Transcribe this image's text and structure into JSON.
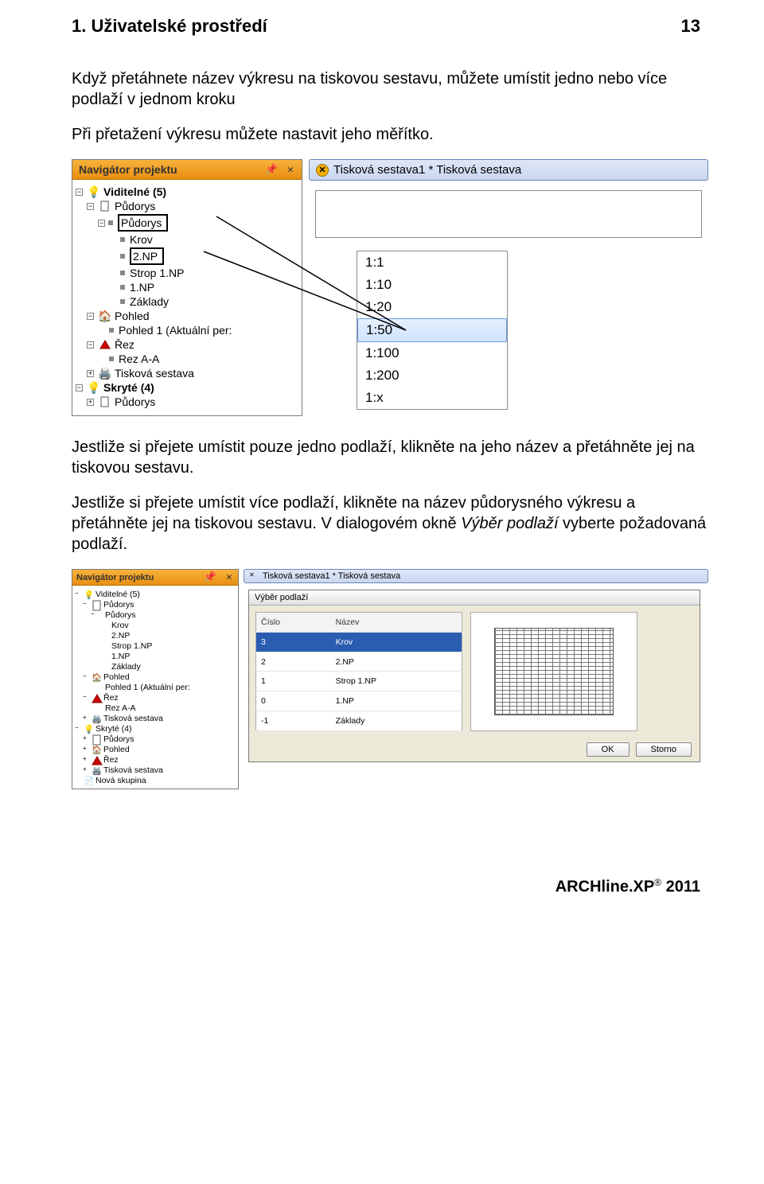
{
  "header": {
    "title": "1. Uživatelské prostředí",
    "page": "13"
  },
  "para1": "Když přetáhnete název výkresu na tiskovou sestavu, můžete umístit jedno nebo více podlaží v jednom kroku",
  "para2": "Při přetažení výkresu můžete nastavit jeho měřítko.",
  "para3": "Jestliže si přejete umístit pouze jedno podlaží, klikněte na jeho název a přetáhněte jej na tiskovou sestavu.",
  "para4a": "Jestliže si přejete umístit více podlaží, klikněte na název půdorysného výkresu a přetáhněte jej na tiskovou sestavu. V dialogovém okně ",
  "para4_italic": "Výběr podlaží",
  "para4b": " vyberte požadovaná podlaží.",
  "footer": {
    "brand": "ARCHline.XP",
    "reg": "®",
    "year": " 2011"
  },
  "shot1": {
    "nav_title": "Navigátor projektu",
    "nav_ctl": "✕",
    "tab_label": "Tisková sestava1 * Tisková sestava",
    "tree": {
      "visible": "Viditelné (5)",
      "pudorys_group": "Půdorys",
      "pudorys": "Půdorys",
      "krov": "Krov",
      "np2": "2.NP",
      "strop": "Strop 1.NP",
      "np1": "1.NP",
      "zaklady": "Základy",
      "pohled": "Pohled",
      "pohled1": "Pohled 1 (Aktuální per:",
      "rez": "Řez",
      "reza": "Rez A-A",
      "tiskova": "Tisková sestava",
      "skryte": "Skryté (4)",
      "pudorys2": "Půdorys"
    },
    "scales": [
      "1:1",
      "1:10",
      "1:20",
      "1:50",
      "1:100",
      "1:200",
      "1:x"
    ],
    "scale_selected": 3
  },
  "shot2": {
    "nav_title": "Navigátor projektu",
    "nav_ctl": "✕",
    "tab_label": "Tisková sestava1 * Tisková sestava",
    "tree": {
      "visible": "Viditelné (5)",
      "pudorys_group": "Půdorys",
      "pudorys": "Půdorys",
      "krov": "Krov",
      "np2": "2.NP",
      "strop": "Strop 1.NP",
      "np1": "1.NP",
      "zaklady": "Základy",
      "pohled": "Pohled",
      "pohled1": "Pohled 1 (Aktuální per:",
      "rez": "Řez",
      "reza": "Rez A-A",
      "tiskova": "Tisková sestava",
      "skryte": "Skryté (4)",
      "pudorys2": "Půdorys",
      "pohled2": "Pohled",
      "rez2": "Řez",
      "tiskova2": "Tisková sestava",
      "nova": "Nová skupina"
    },
    "dlg": {
      "title": "Výběr podlaží",
      "col1": "Číslo",
      "col2": "Název",
      "rows": [
        {
          "n": "3",
          "name": "Krov",
          "sel": true
        },
        {
          "n": "2",
          "name": "2.NP"
        },
        {
          "n": "1",
          "name": "Strop 1.NP"
        },
        {
          "n": "0",
          "name": "1.NP"
        },
        {
          "n": "-1",
          "name": "Základy"
        }
      ],
      "ok": "OK",
      "cancel": "Storno"
    }
  }
}
